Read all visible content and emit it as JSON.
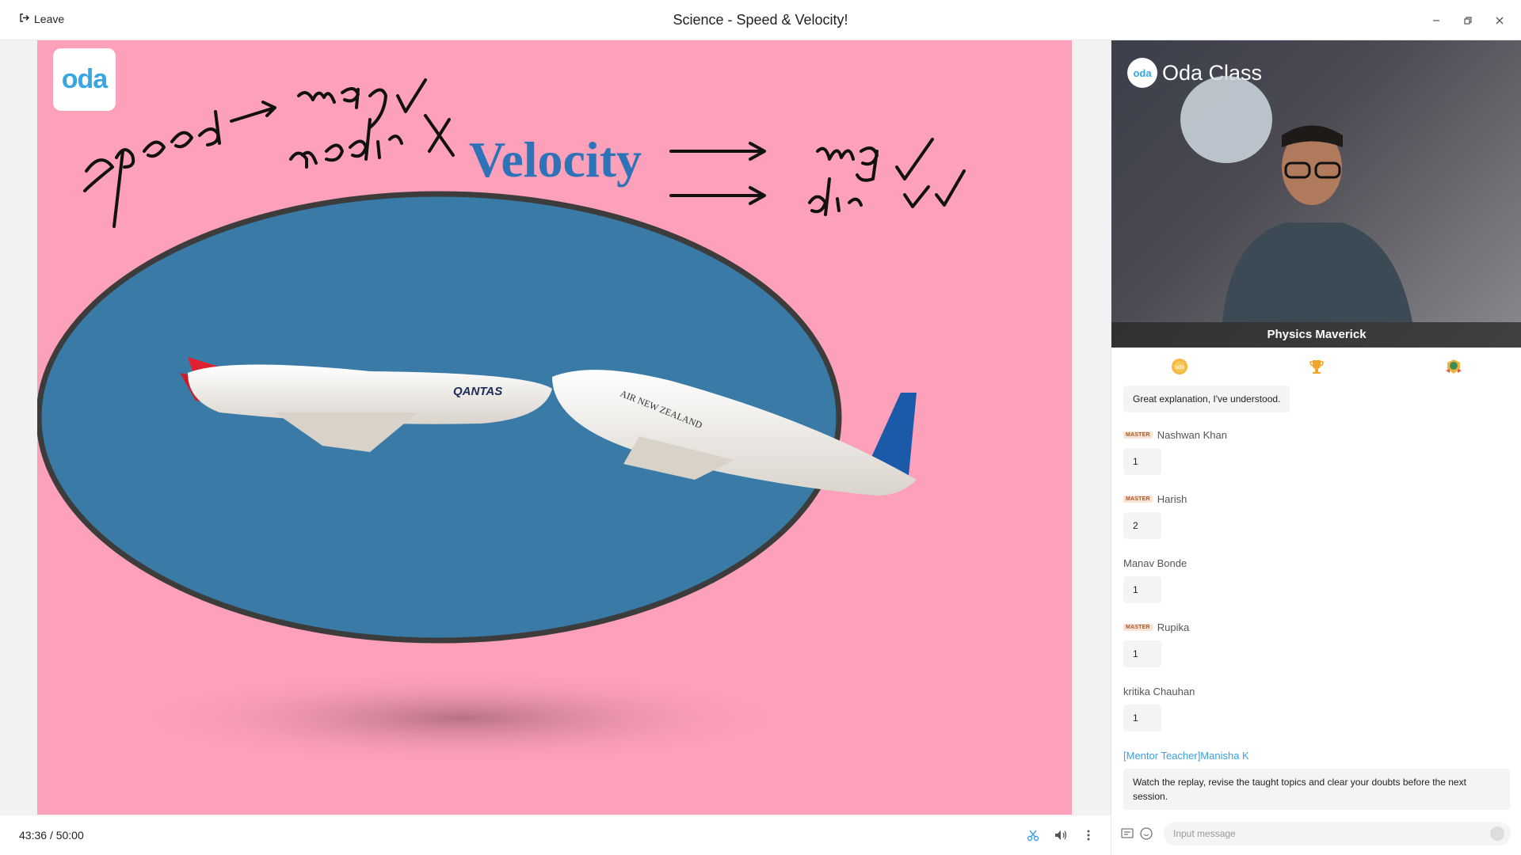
{
  "window": {
    "leave_label": "Leave",
    "title": "Science - Speed & Velocity!"
  },
  "slide": {
    "badge_text": "oda",
    "heading": "Velocity",
    "plane_left_text": "QANTAS",
    "plane_right_text": "AIR NEW ZEALAND",
    "annotations": [
      "speed → mag ✓",
      "no dir ✗",
      "→ mag ✓",
      "→ dir ✓✓"
    ]
  },
  "playback": {
    "current_time": "43:36",
    "separator": "/",
    "total_time": "50:00"
  },
  "video": {
    "brand": "Oda Class",
    "brand_badge": "oda",
    "teacher_name": "Physics Maverick"
  },
  "tabs": [
    {
      "icon": "coin-icon"
    },
    {
      "icon": "trophy-icon"
    },
    {
      "icon": "badge-icon"
    }
  ],
  "chat": {
    "messages": [
      {
        "sender": "",
        "master": false,
        "text": "Great explanation, I've understood."
      },
      {
        "sender": "Nashwan Khan",
        "master": true,
        "text": "1"
      },
      {
        "sender": "Harish",
        "master": true,
        "text": "2"
      },
      {
        "sender": "Manav Bonde",
        "master": false,
        "text": "1"
      },
      {
        "sender": "Rupika",
        "master": true,
        "text": "1"
      },
      {
        "sender": "kritika Chauhan",
        "master": false,
        "text": "1"
      },
      {
        "sender": "[Mentor Teacher]Manisha K",
        "master": false,
        "mentor": true,
        "text": "Watch the replay, revise the taught topics and clear your doubts before the next session."
      }
    ],
    "master_label": "MASTER",
    "input_placeholder": "Input message"
  },
  "colors": {
    "slide_bg": "#fda0b9",
    "heading": "#2e73b8",
    "accent": "#36a7e3",
    "mentor": "#3aa0e0"
  }
}
